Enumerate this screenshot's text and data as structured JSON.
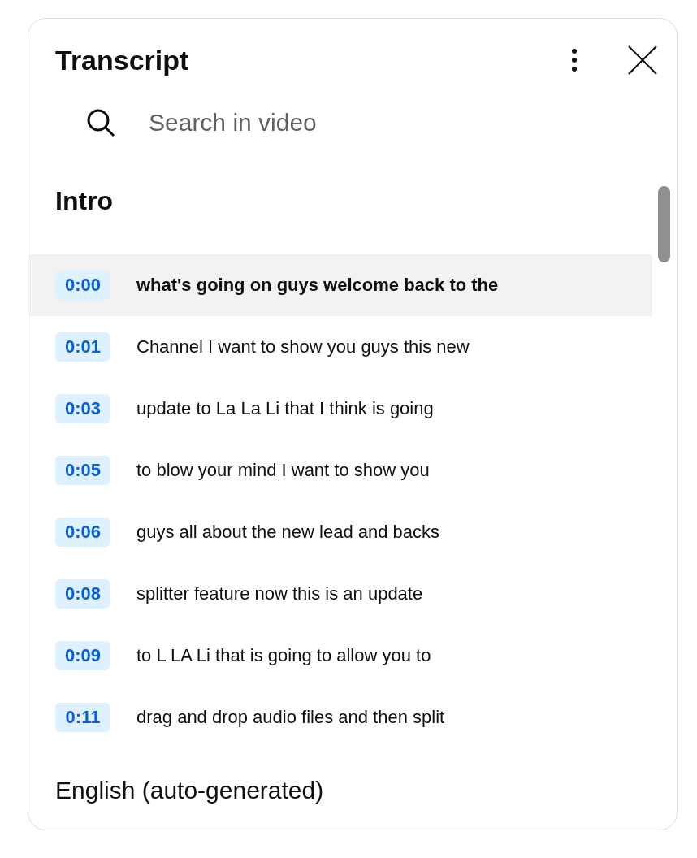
{
  "panel": {
    "title": "Transcript"
  },
  "search": {
    "placeholder": "Search in video"
  },
  "section": {
    "title": "Intro"
  },
  "segments": [
    {
      "time": "0:00",
      "text": "what's going on guys welcome back to the",
      "selected": true
    },
    {
      "time": "0:01",
      "text": "Channel I want to show you guys this new",
      "selected": false
    },
    {
      "time": "0:03",
      "text": "update to La La Li that I think is going",
      "selected": false
    },
    {
      "time": "0:05",
      "text": "to blow your mind I want to show you",
      "selected": false
    },
    {
      "time": "0:06",
      "text": "guys all about the new lead and backs",
      "selected": false
    },
    {
      "time": "0:08",
      "text": "splitter feature now this is an update",
      "selected": false
    },
    {
      "time": "0:09",
      "text": "to L LA Li that is going to allow you to",
      "selected": false
    },
    {
      "time": "0:11",
      "text": "drag and drop audio files and then split",
      "selected": false
    }
  ],
  "footer": {
    "language": "English (auto-generated)"
  }
}
